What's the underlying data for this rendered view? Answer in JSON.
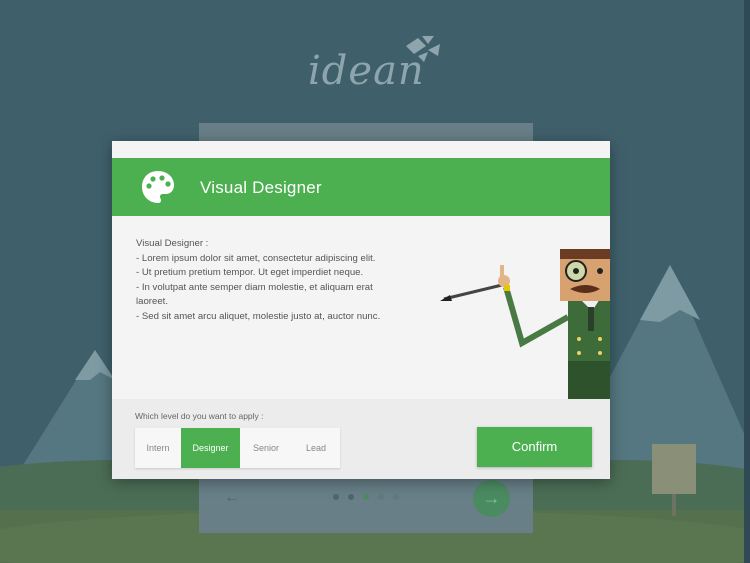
{
  "brand": {
    "logo_text": "idean"
  },
  "modal": {
    "title": "Visual Designer",
    "description_title": "Visual Designer :",
    "description_lines": [
      "- Lorem ipsum dolor sit amet, consectetur adipiscing elit.",
      "- Ut pretium pretium tempor. Ut eget imperdiet neque.",
      "- In volutpat ante semper diam molestie, et aliquam erat laoreet.",
      "- Sed sit amet arcu aliquet, molestie justo at, auctor nunc."
    ],
    "level_prompt": "Which level do you want to apply :",
    "levels": [
      "Intern",
      "Designer",
      "Senior",
      "Lead"
    ],
    "selected_level": "Designer",
    "confirm_label": "Confirm"
  },
  "background_nav": {
    "prev_icon": "arrow-left-icon",
    "next_icon": "arrow-right-icon",
    "step_count": 5,
    "active_step": 3
  },
  "colors": {
    "accent": "#4caf50",
    "background": "#3d5e6a"
  }
}
